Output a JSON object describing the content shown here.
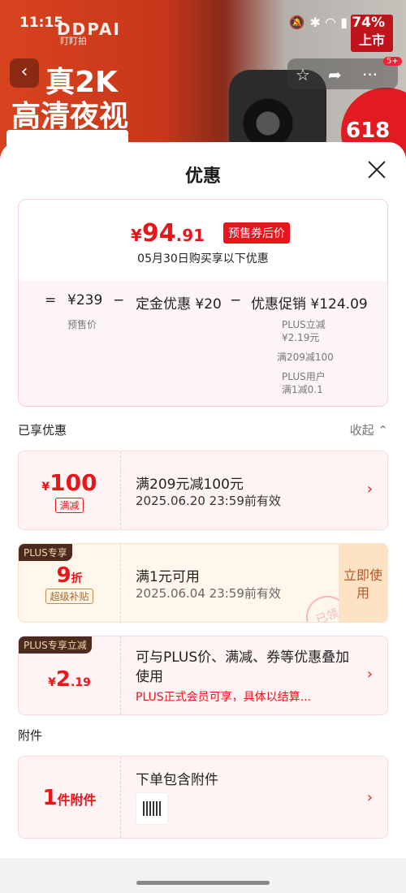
{
  "status_bar": {
    "time": "11:15",
    "battery": "74%"
  },
  "background": {
    "brand": "DDPAI",
    "brand_sub": "盯盯拍",
    "headline_1": "真2K",
    "headline_2": "高清夜视",
    "new_tag": "上市",
    "cart_count": "5+",
    "promo_badge": "618"
  },
  "sheet": {
    "title": "优惠",
    "price_summary": {
      "currency": "¥",
      "price_int": "94",
      "price_dec": ".91",
      "price_label": "预售券后价",
      "date_note": "05月30日购买享以下优惠",
      "equation": {
        "eq": "=",
        "presale_price": "¥239",
        "presale_label": "预售价",
        "minus1": "−",
        "deposit": "定金优惠 ¥20",
        "minus2": "−",
        "promo": "优惠促销 ¥124.09",
        "promo_items": [
          "PLUS立减",
          "¥2.19元",
          "满209减100",
          "PLUS用户",
          "满1减0.1"
        ]
      }
    },
    "enjoyed_label": "已享优惠",
    "collapse_label": "收起",
    "coupons": [
      {
        "amount_cur": "¥",
        "amount": "100",
        "tag": "满减",
        "title": "满209元减100元",
        "sub": "2025.06.20 23:59前有效"
      },
      {
        "corner": "PLUS专享",
        "amount": "9",
        "amount_unit": "折",
        "tag": "超级补贴",
        "title": "满1元可用",
        "sub": "2025.06.04 23:59前有效",
        "action": "立即使用",
        "stamp": "已领"
      },
      {
        "corner": "PLUS专享立减",
        "amount_cur": "¥",
        "amount": "2",
        "amount_dec": ".19",
        "title": "可与PLUS价、满减、券等优惠叠加使用",
        "sub": "PLUS正式会员可享，具体以结算..."
      }
    ],
    "accessory_label": "附件",
    "accessory": {
      "count": "1",
      "count_unit": "件附件",
      "title": "下单包含附件"
    }
  },
  "colors": {
    "accent": "#e8151b",
    "plus_dark": "#4a2b1e",
    "plus_gold": "#f6d7a8"
  }
}
